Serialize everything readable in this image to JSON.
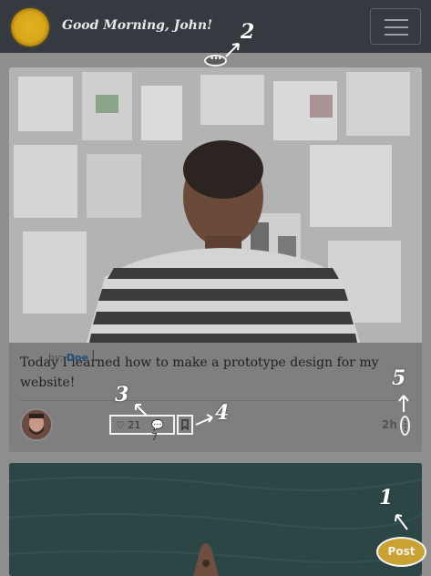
{
  "header": {
    "greeting": "Good Morning, John!",
    "menu_icon": "hamburger-icon"
  },
  "annotations": {
    "n1": "1",
    "n2": "2",
    "n3": "3",
    "n4": "4",
    "n5": "5"
  },
  "options_pill": {
    "label": "•••"
  },
  "post": {
    "text": "Today I learned how to make a prototype design for my website!",
    "by_label": "by:",
    "author": "Doe",
    "separator": "|",
    "likes": "21",
    "comments": "7",
    "time_ago": "2h"
  },
  "fab": {
    "label": "Post"
  },
  "colors": {
    "header_bg": "#343a40",
    "accent_gold": "#c9a233",
    "author_link": "#1f4d7a"
  }
}
